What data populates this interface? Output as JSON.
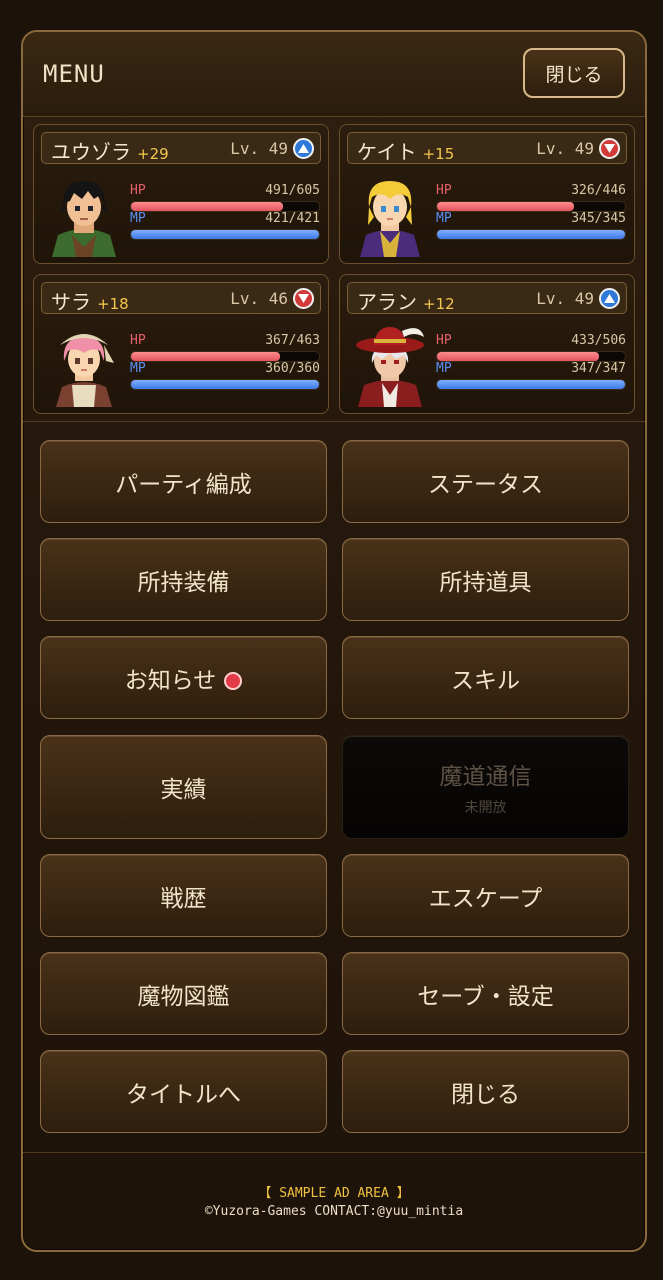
{
  "header": {
    "title": "MENU",
    "close_label": "閉じる"
  },
  "party": [
    {
      "name": "ユウゾラ",
      "bonus": "+29",
      "level": "Lv. 49",
      "trend": "up",
      "hp_label": "HP",
      "mp_label": "MP",
      "hp_text": "491/605",
      "mp_text": "421/421",
      "hp_ratio": 0.81,
      "mp_ratio": 1.0,
      "portrait": "hero-portrait"
    },
    {
      "name": "ケイト",
      "bonus": "+15",
      "level": "Lv. 49",
      "trend": "down",
      "hp_label": "HP",
      "mp_label": "MP",
      "hp_text": "326/446",
      "mp_text": "345/345",
      "hp_ratio": 0.73,
      "mp_ratio": 1.0,
      "portrait": "blonde-mage-portrait"
    },
    {
      "name": "サラ",
      "bonus": "+18",
      "level": "Lv. 46",
      "trend": "down",
      "hp_label": "HP",
      "mp_label": "MP",
      "hp_text": "367/463",
      "mp_text": "360/360",
      "hp_ratio": 0.79,
      "mp_ratio": 1.0,
      "portrait": "pink-hair-portrait"
    },
    {
      "name": "アラン",
      "bonus": "+12",
      "level": "Lv. 49",
      "trend": "up",
      "hp_label": "HP",
      "mp_label": "MP",
      "hp_text": "433/506",
      "mp_text": "347/347",
      "hp_ratio": 0.86,
      "mp_ratio": 1.0,
      "portrait": "red-hat-swordsman-portrait"
    }
  ],
  "buttons": {
    "party_formation": "パーティ編成",
    "status": "ステータス",
    "equipment": "所持装備",
    "items": "所持道具",
    "news": "お知らせ",
    "skills": "スキル",
    "achievements": "実績",
    "magic_comm": "魔道通信",
    "magic_comm_sub": "未開放",
    "battle_history": "戦歴",
    "escape": "エスケープ",
    "bestiary": "魔物図鑑",
    "save_settings": "セーブ・設定",
    "to_title": "タイトルへ",
    "close": "閉じる"
  },
  "footer": {
    "ad": "【 SAMPLE AD AREA 】",
    "copyright": "©Yuzora-Games CONTACT:@yuu_mintia"
  },
  "colors": {
    "accent_gold": "#f4c84c",
    "hp": "#e0545e",
    "mp": "#3d78e6",
    "notice_dot": "#e33a47"
  }
}
